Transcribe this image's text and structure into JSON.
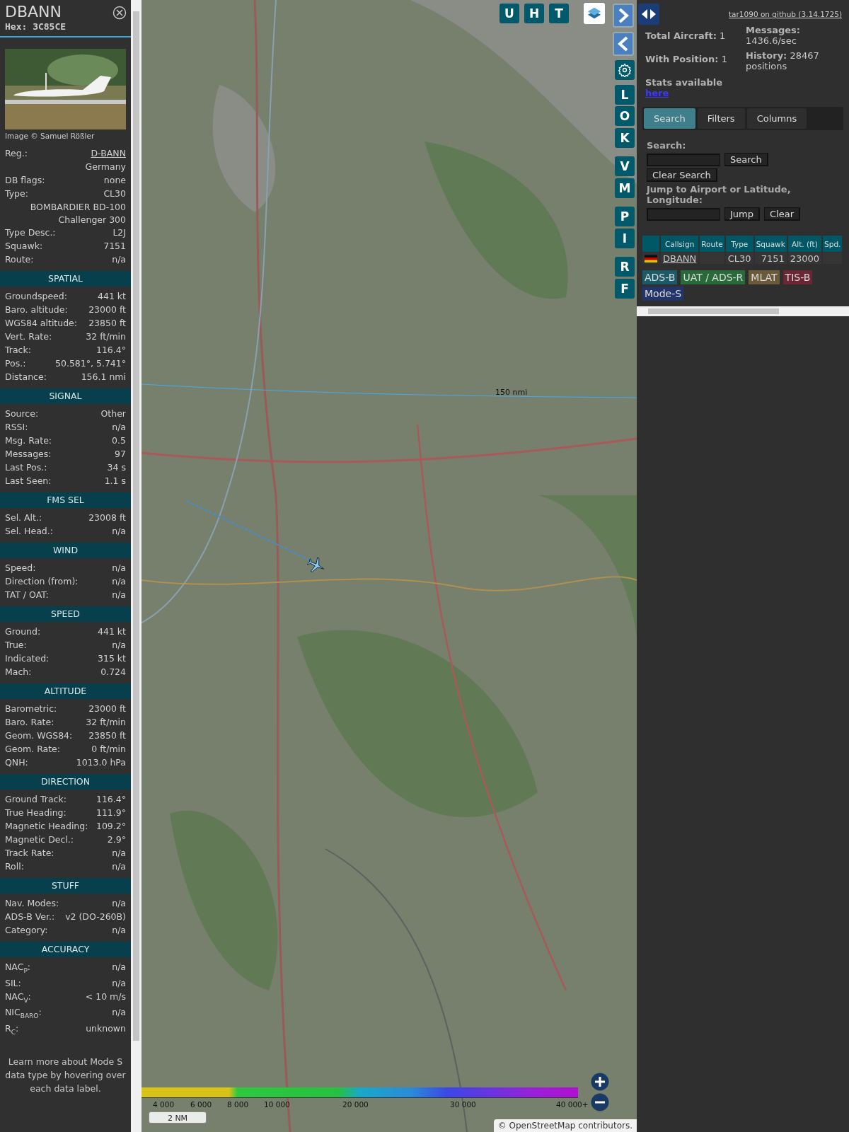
{
  "aircraft": {
    "callsign": "DBANN",
    "hex_label": "Hex:",
    "hex": "3C85CE",
    "image_credit": "Image © Samuel Rößler"
  },
  "details": [
    {
      "label": "Reg.:",
      "value": "D-BANN",
      "link": true
    },
    {
      "value": "Germany"
    },
    {
      "label": "DB flags:",
      "value": "none"
    },
    {
      "label": "Type:",
      "value": "CL30"
    },
    {
      "value": "BOMBARDIER BD-100\nChallenger 300"
    },
    {
      "label": "Type Desc.:",
      "value": "L2J"
    },
    {
      "label": "Squawk:",
      "value": "7151"
    },
    {
      "label": "Route:",
      "value": "n/a"
    }
  ],
  "sections": [
    {
      "title": "SPATIAL",
      "rows": [
        {
          "label": "Groundspeed:",
          "value": "441 kt"
        },
        {
          "label": "Baro. altitude:",
          "value": "23000 ft"
        },
        {
          "label": "WGS84 altitude:",
          "value": "23850 ft"
        },
        {
          "label": "Vert. Rate:",
          "value": "32 ft/min"
        },
        {
          "label": "Track:",
          "value": "116.4°"
        },
        {
          "label": "Pos.:",
          "value": "50.581°, 5.741°"
        },
        {
          "label": "Distance:",
          "value": "156.1 nmi"
        }
      ]
    },
    {
      "title": "SIGNAL",
      "rows": [
        {
          "label": "Source:",
          "value": "Other"
        },
        {
          "label": "RSSI:",
          "value": "n/a"
        },
        {
          "label": "Msg. Rate:",
          "value": "0.5"
        },
        {
          "label": "Messages:",
          "value": "97"
        },
        {
          "label": "Last Pos.:",
          "value": "34 s"
        },
        {
          "label": "Last Seen:",
          "value": "1.1 s"
        }
      ]
    },
    {
      "title": "FMS SEL",
      "rows": [
        {
          "label": "Sel. Alt.:",
          "value": "23008 ft"
        },
        {
          "label": "Sel. Head.:",
          "value": "n/a"
        }
      ]
    },
    {
      "title": "WIND",
      "rows": [
        {
          "label": "Speed:",
          "value": "n/a"
        },
        {
          "label": "Direction (from):",
          "value": "n/a"
        },
        {
          "label": "TAT / OAT:",
          "value": "n/a"
        }
      ]
    },
    {
      "title": "SPEED",
      "rows": [
        {
          "label": "Ground:",
          "value": "441 kt"
        },
        {
          "label": "True:",
          "value": "n/a"
        },
        {
          "label": "Indicated:",
          "value": "315 kt"
        },
        {
          "label": "Mach:",
          "value": "0.724"
        }
      ]
    },
    {
      "title": "ALTITUDE",
      "rows": [
        {
          "label": "Barometric:",
          "value": "23000 ft"
        },
        {
          "label": "Baro. Rate:",
          "value": "32 ft/min"
        },
        {
          "label": "Geom. WGS84:",
          "value": "23850 ft"
        },
        {
          "label": "Geom. Rate:",
          "value": "0 ft/min"
        },
        {
          "label": "QNH:",
          "value": "1013.0 hPa"
        }
      ]
    },
    {
      "title": "DIRECTION",
      "rows": [
        {
          "label": "Ground Track:",
          "value": "116.4°"
        },
        {
          "label": "True Heading:",
          "value": "111.9°"
        },
        {
          "label": "Magnetic Heading:",
          "value": "109.2°"
        },
        {
          "label": "Magnetic Decl.:",
          "value": "2.9°"
        },
        {
          "label": "Track Rate:",
          "value": "n/a"
        },
        {
          "label": "Roll:",
          "value": "n/a"
        }
      ]
    },
    {
      "title": "STUFF",
      "rows": [
        {
          "label": "Nav. Modes:",
          "value": "n/a"
        },
        {
          "label": "ADS-B Ver.:",
          "value": "v2 (DO-260B)"
        },
        {
          "label": "Category:",
          "value": "n/a"
        }
      ]
    },
    {
      "title": "ACCURACY",
      "rows": [
        {
          "label": "NAC$_{P}$:",
          "value": "n/a"
        },
        {
          "label": "SIL:",
          "value": "n/a"
        },
        {
          "label": "NAC$_{V}$:",
          "value": "< 10 m/s"
        },
        {
          "label": "NIC$_{BARO}$:",
          "value": "n/a"
        },
        {
          "label": "R$_{C}$:",
          "value": "unknown"
        }
      ]
    }
  ],
  "footer_note": "Learn more about Mode S data type by hovering over each data label.",
  "map": {
    "top_buttons": [
      "U",
      "H",
      "T"
    ],
    "side_buttons": [
      {
        "kind": "next"
      },
      {
        "kind": "prev"
      },
      {
        "kind": "settings"
      },
      {
        "kind": "letter",
        "label": "L"
      },
      {
        "kind": "letter",
        "label": "O"
      },
      {
        "kind": "letter",
        "label": "K"
      },
      {
        "kind": "letter",
        "label": "V"
      },
      {
        "kind": "letter",
        "label": "M"
      },
      {
        "kind": "letter",
        "label": "P"
      },
      {
        "kind": "letter",
        "label": "I"
      },
      {
        "kind": "letter",
        "label": "R"
      },
      {
        "kind": "letter",
        "label": "F"
      }
    ],
    "range_ring_label": "150 nmi",
    "legend_ticks": [
      "4 000",
      "6 000",
      "8 000",
      "10 000",
      "20 000",
      "30 000",
      "40 000+"
    ],
    "scale_label": "2 NM",
    "attribution": "© OpenStreetMap contributors."
  },
  "right": {
    "version_link": "tar1090 on github (3.14.1725)",
    "stats_left": [
      {
        "label": "Total Aircraft:",
        "value": "1"
      },
      {
        "label": "With Position:",
        "value": "1"
      }
    ],
    "stats_right": [
      {
        "label": "Messages:",
        "value": "1436.6/sec"
      },
      {
        "label": "History:",
        "value": "28467 positions"
      }
    ],
    "stats_text": "Stats available",
    "stats_link": "here",
    "tabs": [
      {
        "label": "Search",
        "selected": true
      },
      {
        "label": "Filters",
        "selected": false
      },
      {
        "label": "Columns",
        "selected": false
      }
    ],
    "search_label": "Search:",
    "search_button": "Search",
    "clear_search_button": "Clear Search",
    "jump_label": "Jump to Airport or Latitude, Longitude:",
    "jump_button": "Jump",
    "clear_button": "Clear",
    "columns": [
      "Callsign",
      "Route",
      "Type",
      "Squawk",
      "Alt. (ft)",
      "Spd."
    ],
    "rows": [
      {
        "callsign": "DBANN",
        "type": "CL30",
        "squawk": "7151",
        "altitude": "23000"
      }
    ],
    "sources": [
      {
        "label": "ADS-B",
        "color": "#1d5a68"
      },
      {
        "label": "UAT / ADS-R",
        "color": "#2a6a3a"
      },
      {
        "label": "MLAT",
        "color": "#6a5a3a"
      },
      {
        "label": "TIS-B",
        "color": "#6a2632"
      },
      {
        "label": "Mode-S",
        "color": "#23346a"
      }
    ]
  }
}
